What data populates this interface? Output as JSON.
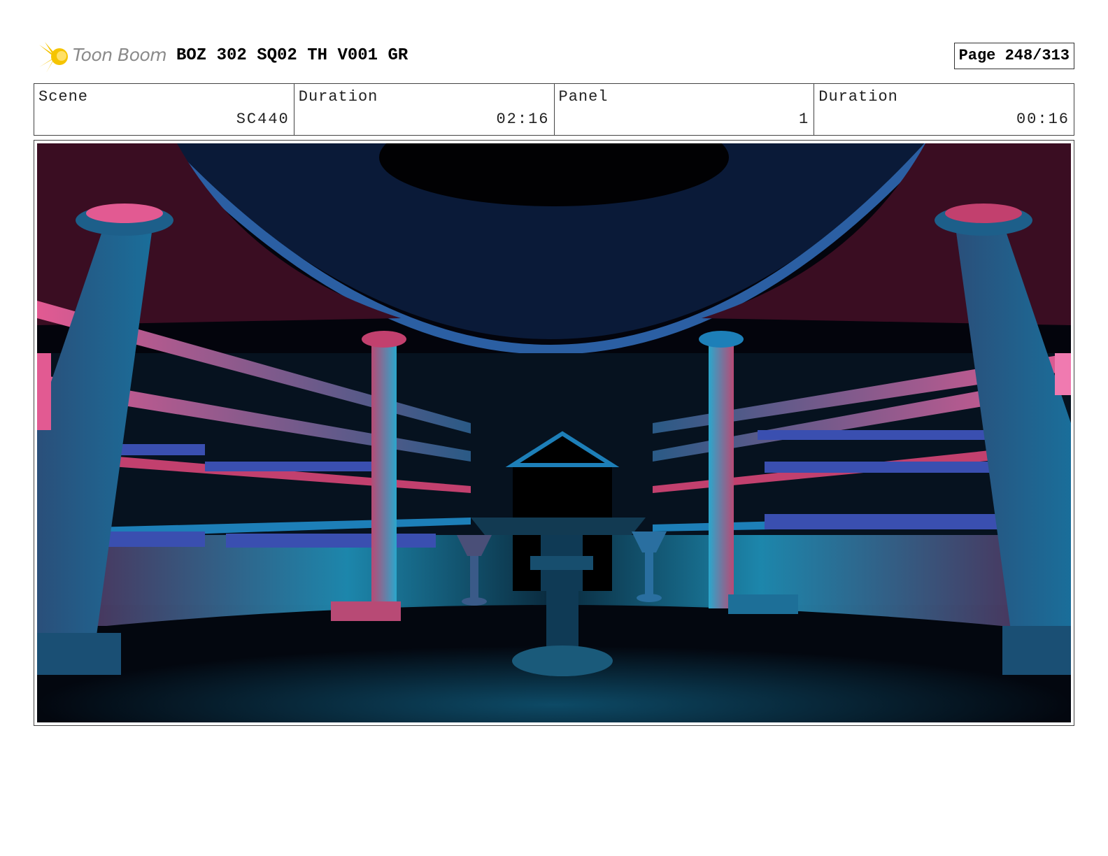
{
  "header": {
    "logo_text": "Toon Boom",
    "title": "BOZ 302 SQ02 TH V001 GR",
    "page": "Page 248/313"
  },
  "info": {
    "scene_label": "Scene",
    "scene_value": "SC440",
    "scene_duration_label": "Duration",
    "scene_duration_value": "02:16",
    "panel_label": "Panel",
    "panel_value": "1",
    "panel_duration_label": "Duration",
    "panel_duration_value": "00:16"
  },
  "colors": {
    "logo_yellow": "#f5c400",
    "scene_blue": "#1d7fb8",
    "scene_cyan": "#2fb5d9",
    "scene_magenta": "#c2406e",
    "scene_dark": "#03040c"
  }
}
